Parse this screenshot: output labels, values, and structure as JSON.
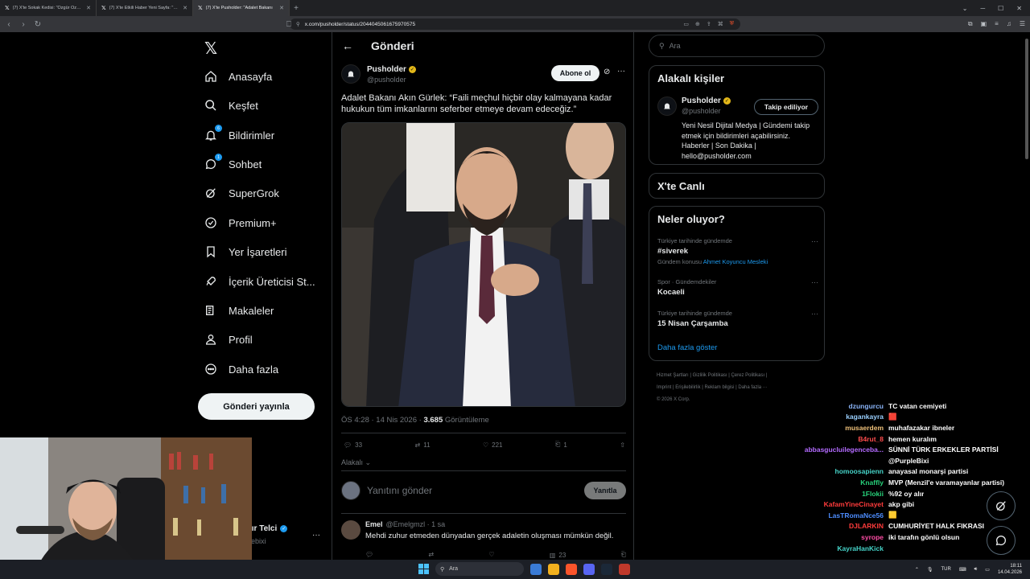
{
  "browser": {
    "tabs": [
      {
        "label": "(7) X'te Sokak Kedisi: \"Özgür Özel: \"Y",
        "active": false
      },
      {
        "label": "(7) X'te Etkili Haber Yeni Sayfa: \"Fatih",
        "active": false
      },
      {
        "label": "(7) X'te Pusholder: \"Adalet Bakanı",
        "active": true
      }
    ],
    "url": "x.com/pusholder/status/2044045061675970575"
  },
  "nav": {
    "items": [
      {
        "label": "Anasayfa",
        "icon": "home-icon"
      },
      {
        "label": "Keşfet",
        "icon": "search-icon"
      },
      {
        "label": "Bildirimler",
        "icon": "bell-icon",
        "badge": "6"
      },
      {
        "label": "Sohbet",
        "icon": "chat-icon",
        "badge": "1"
      },
      {
        "label": "SuperGrok",
        "icon": "grok-icon"
      },
      {
        "label": "Premium+",
        "icon": "premium-icon"
      },
      {
        "label": "Yer İşaretleri",
        "icon": "bookmark-icon"
      },
      {
        "label": "İçerik Üreticisi St...",
        "icon": "rocket-icon"
      },
      {
        "label": "Makaleler",
        "icon": "article-icon"
      },
      {
        "label": "Profil",
        "icon": "person-icon"
      },
      {
        "label": "Daha fazla",
        "icon": "more-circle-icon"
      }
    ],
    "post_button": "Gönderi yayınla",
    "account_name": "lır Telci",
    "account_handle": "lebixi"
  },
  "header": {
    "title": "Gönderi"
  },
  "tweet": {
    "author_name": "Pusholder",
    "author_handle": "@pusholder",
    "subscribe": "Abone ol",
    "text": "Adalet Bakanı Akın Gürlek: “Faili meçhul hiçbir olay kalmayana kadar hukukun tüm imkanlarını seferber etmeye devam edeceğiz.”",
    "time": "ÖS 4:28 · 14 Nis 2026 · ",
    "views": "3.685",
    "views_label": " Görüntüleme",
    "replies": "33",
    "reposts": "11",
    "likes": "221",
    "bookmarks": "1",
    "relevance": "Alakalı"
  },
  "reply": {
    "placeholder": "Yanıtını gönder",
    "button": "Yanıtla"
  },
  "comment": {
    "name": "Emel",
    "handle": "@Emelgmzl · 1 sa",
    "text": "Mehdi zuhur etmeden dünyadan gerçek adaletin oluşması mümkün değil.",
    "views": "23"
  },
  "right": {
    "search_placeholder": "Ara",
    "related_title": "Alakalı kişiler",
    "related_name": "Pusholder",
    "related_handle": "@pusholder",
    "related_button": "Takip ediliyor",
    "related_bio": "Yeni Nesil Dijital Medya | Gündemi takip etmek için bildirimleri açabilirsiniz. Haberler | Son Dakika | hello@pusholder.com",
    "live_title": "X'te Canlı",
    "trends_title": "Neler oluyor?",
    "trends": [
      {
        "category": "Türkiye tarihinde gündemde",
        "name": "#siverek",
        "context_prefix": "Gündem konusu ",
        "context_link": "Ahmet Koyuncu Mesleki"
      },
      {
        "category": "Spor · Gündemdekiler",
        "name": "Kocaeli",
        "context_prefix": "",
        "context_link": ""
      },
      {
        "category": "Türkiye tarihinde gündemde",
        "name": "15 Nisan Çarşamba",
        "context_prefix": "",
        "context_link": ""
      }
    ],
    "show_more": "Daha fazla göster",
    "footer_lines": [
      "Hizmet Şartları  |  Gizlilik Politikası  |  Çerez Politikası  |",
      "Imprint  |  Erişilebilirlik  |  Reklam bilgisi  |  Daha fazla ···",
      "© 2026 X Corp."
    ]
  },
  "chat": [
    {
      "user": "dzungurcu",
      "msg": "TC vatan cemiyeti",
      "color": "#8ab4f8"
    },
    {
      "user": "kagankayra",
      "msg": "🟥",
      "color": "#9ad0ff"
    },
    {
      "user": "musaerdem",
      "msg": "muhafazakar ibneler",
      "color": "#f0c27b"
    },
    {
      "user": "B4rut_8",
      "msg": "hemen kuralım",
      "color": "#ff4d4d"
    },
    {
      "user": "abbasgucluilegenceba...",
      "msg": "SÜNNİ TÜRK ERKEKLER PARTİSİ",
      "color": "#b36bff"
    },
    {
      "user": "",
      "msg": "@PurpleBixi",
      "color": "#ffffff"
    },
    {
      "user": "homoosapienn",
      "msg": "anayasal monarşi partisi",
      "color": "#46d4c9"
    },
    {
      "user": "Knaffly",
      "msg": "MVP (Menzil'e varamayanlar partisi)",
      "color": "#27d17a"
    },
    {
      "user": "1Flokii",
      "msg": "%92 oy alır",
      "color": "#27d17a"
    },
    {
      "user": "KafamYineCinayet",
      "msg": "akp gibi",
      "color": "#ff3b3b"
    },
    {
      "user": "LasTRomaNce56",
      "msg": "🟨",
      "color": "#4d8dff"
    },
    {
      "user": "DJLARKIN",
      "msg": "CUMHURİYET HALK FIKRASI",
      "color": "#ff3b3b"
    },
    {
      "user": "syrope",
      "msg": "iki tarafın gönlü olsun",
      "color": "#ff4da6"
    },
    {
      "user": "KayraHanKick",
      "msg": "",
      "color": "#46d4c9"
    }
  ],
  "taskbar": {
    "search": "Ara",
    "lang": "TUR",
    "time": "18:11",
    "date": "14.04.2026"
  }
}
